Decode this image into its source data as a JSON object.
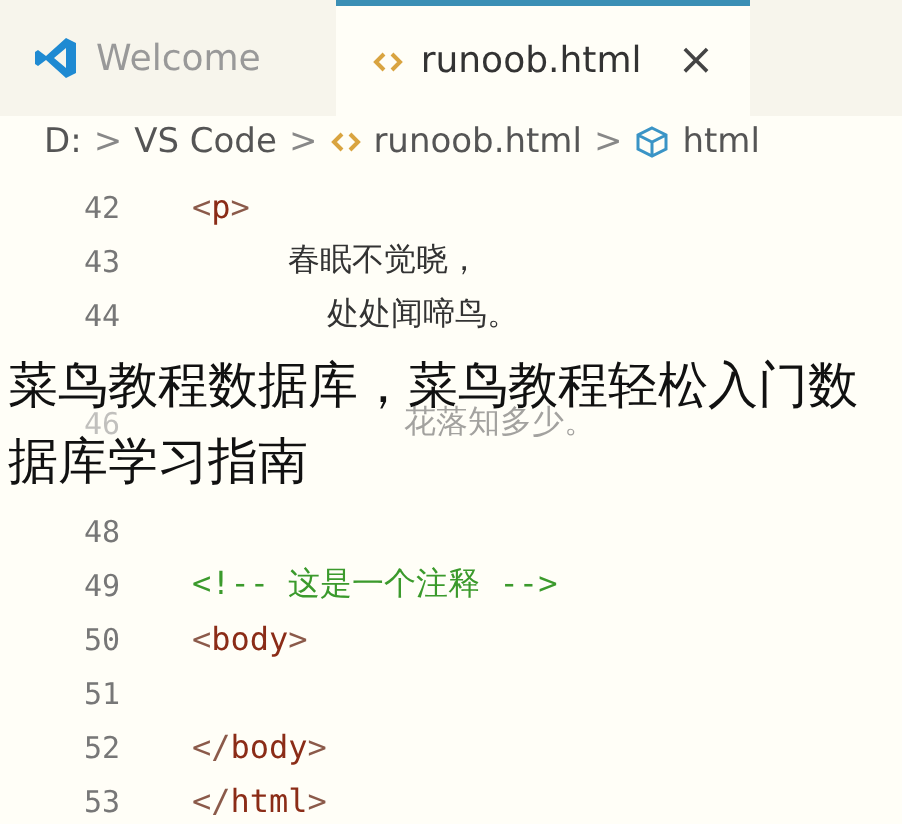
{
  "tabs": [
    {
      "label": "Welcome",
      "kind": "vscode",
      "selected": false,
      "closable": false
    },
    {
      "label": "runoob.html",
      "kind": "html",
      "selected": true,
      "closable": true
    }
  ],
  "close_symbol": "×",
  "breadcrumb": [
    {
      "label": "D:",
      "kind": "folder"
    },
    {
      "label": "VS Code",
      "kind": "folder"
    },
    {
      "label": "runoob.html",
      "kind": "html"
    },
    {
      "label": "html",
      "kind": "element"
    }
  ],
  "breadcrumb_separator": ">",
  "lines": [
    {
      "number": "42",
      "kind": "tag",
      "code": "<p>"
    },
    {
      "number": "43",
      "kind": "text",
      "code": "     春眠不觉晓，"
    },
    {
      "number": "44",
      "kind": "text",
      "code": "       处处闻啼鸟。"
    },
    {
      "kind": "covered"
    },
    {
      "number": "46",
      "kind": "text",
      "code": "           花落知多少。"
    },
    {
      "kind": "covered"
    },
    {
      "number": "48",
      "kind": "blank"
    },
    {
      "number": "49",
      "kind": "comment",
      "code": "<!-- 这是一个注释 -->"
    },
    {
      "number": "50",
      "kind": "tag",
      "code": "<body>"
    },
    {
      "number": "51",
      "kind": "blank"
    },
    {
      "number": "52",
      "kind": "tag",
      "code": "</body>"
    },
    {
      "number": "53",
      "kind": "tag",
      "code": "</html>"
    }
  ],
  "caption": "菜鸟教程数据库，菜鸟教程轻松入门数据库学习指南"
}
